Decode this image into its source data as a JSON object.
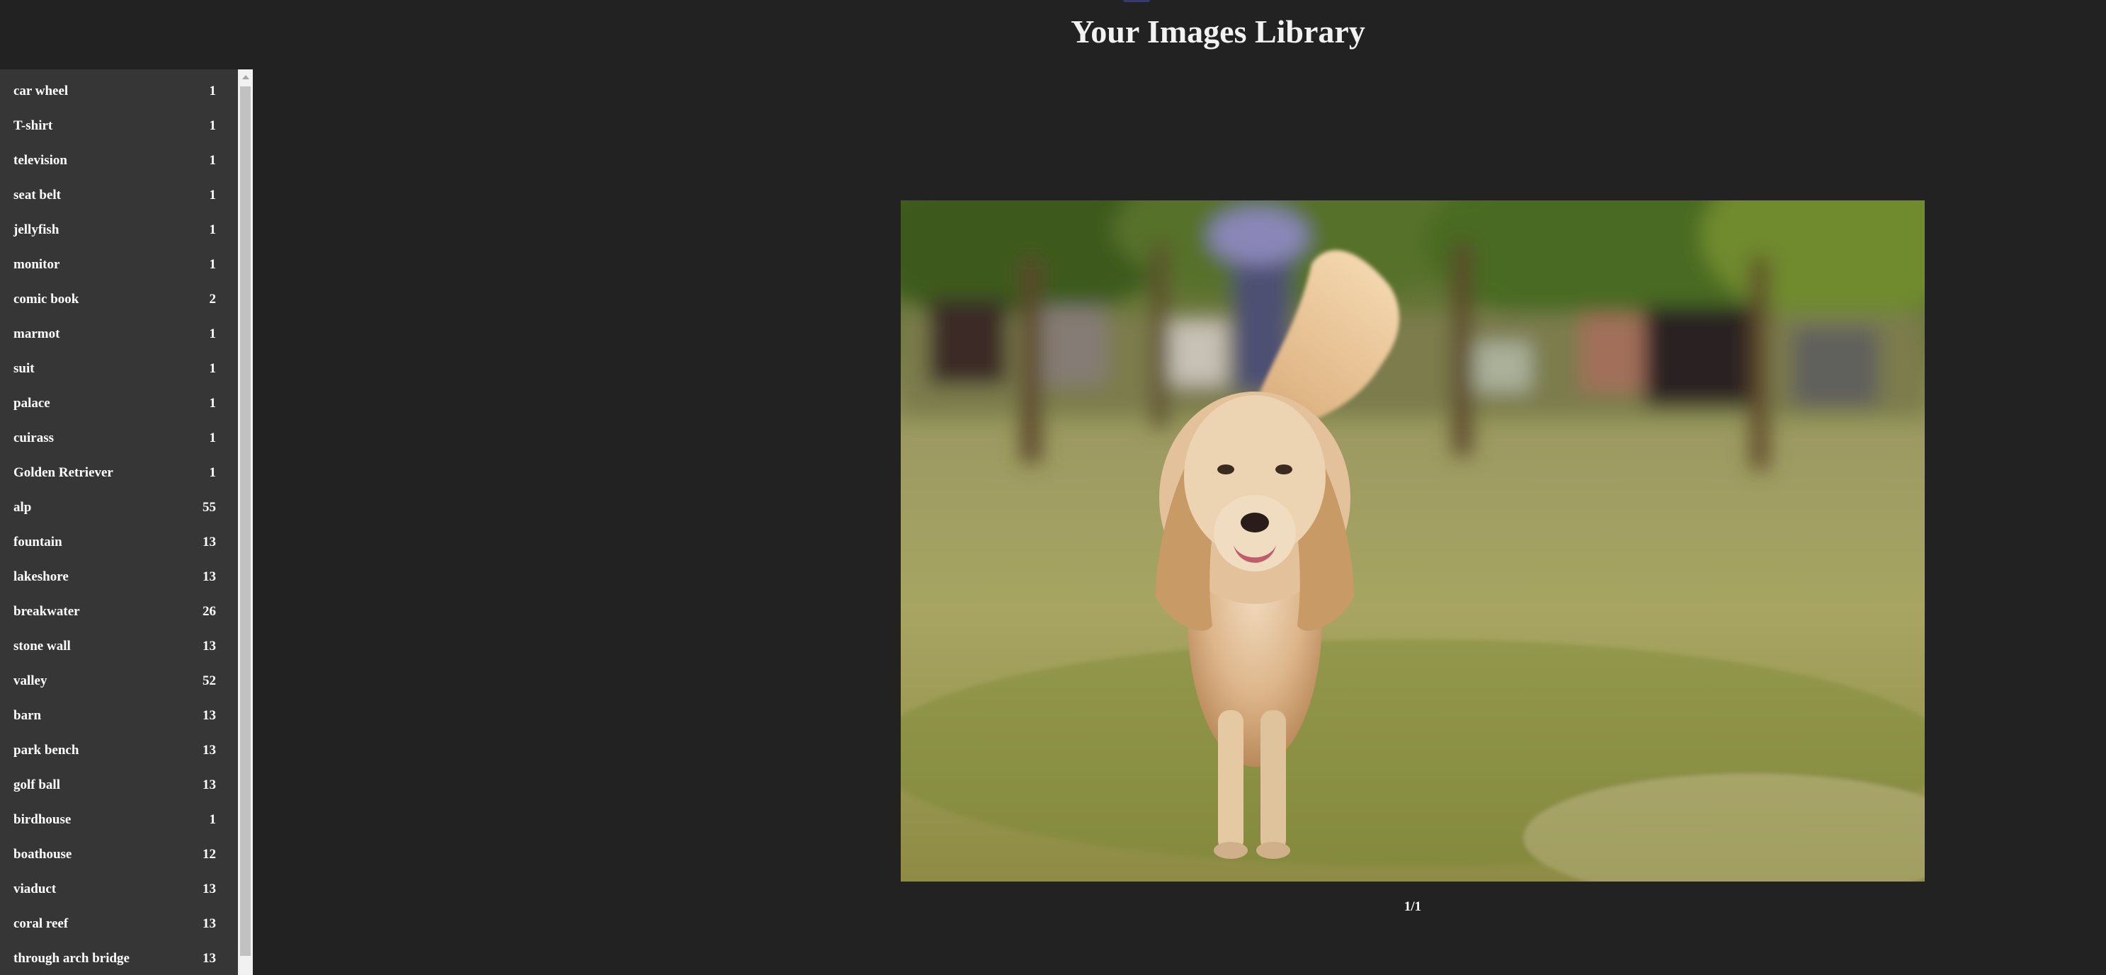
{
  "header": {
    "title": "Your Images Library"
  },
  "sidebar": {
    "items": [
      {
        "label": "car wheel",
        "count": "1"
      },
      {
        "label": "T-shirt",
        "count": "1"
      },
      {
        "label": "television",
        "count": "1"
      },
      {
        "label": "seat belt",
        "count": "1"
      },
      {
        "label": "jellyfish",
        "count": "1"
      },
      {
        "label": "monitor",
        "count": "1"
      },
      {
        "label": "comic book",
        "count": "2"
      },
      {
        "label": "marmot",
        "count": "1"
      },
      {
        "label": "suit",
        "count": "1"
      },
      {
        "label": "palace",
        "count": "1"
      },
      {
        "label": "cuirass",
        "count": "1"
      },
      {
        "label": "Golden Retriever",
        "count": "1"
      },
      {
        "label": "alp",
        "count": "55"
      },
      {
        "label": "fountain",
        "count": "13"
      },
      {
        "label": "lakeshore",
        "count": "13"
      },
      {
        "label": "breakwater",
        "count": "26"
      },
      {
        "label": "stone wall",
        "count": "13"
      },
      {
        "label": "valley",
        "count": "52"
      },
      {
        "label": "barn",
        "count": "13"
      },
      {
        "label": "park bench",
        "count": "13"
      },
      {
        "label": "golf ball",
        "count": "13"
      },
      {
        "label": "birdhouse",
        "count": "1"
      },
      {
        "label": "boathouse",
        "count": "12"
      },
      {
        "label": "viaduct",
        "count": "13"
      },
      {
        "label": "coral reef",
        "count": "13"
      },
      {
        "label": "through arch bridge",
        "count": "13"
      }
    ]
  },
  "viewer": {
    "image_subject": "golden-retriever-photo",
    "pagination": "1/1"
  },
  "colors": {
    "background": "#222222",
    "sidebar": "#363636",
    "scrollbar_track": "#f1f1f1",
    "scrollbar_thumb": "#c1c1c1"
  }
}
